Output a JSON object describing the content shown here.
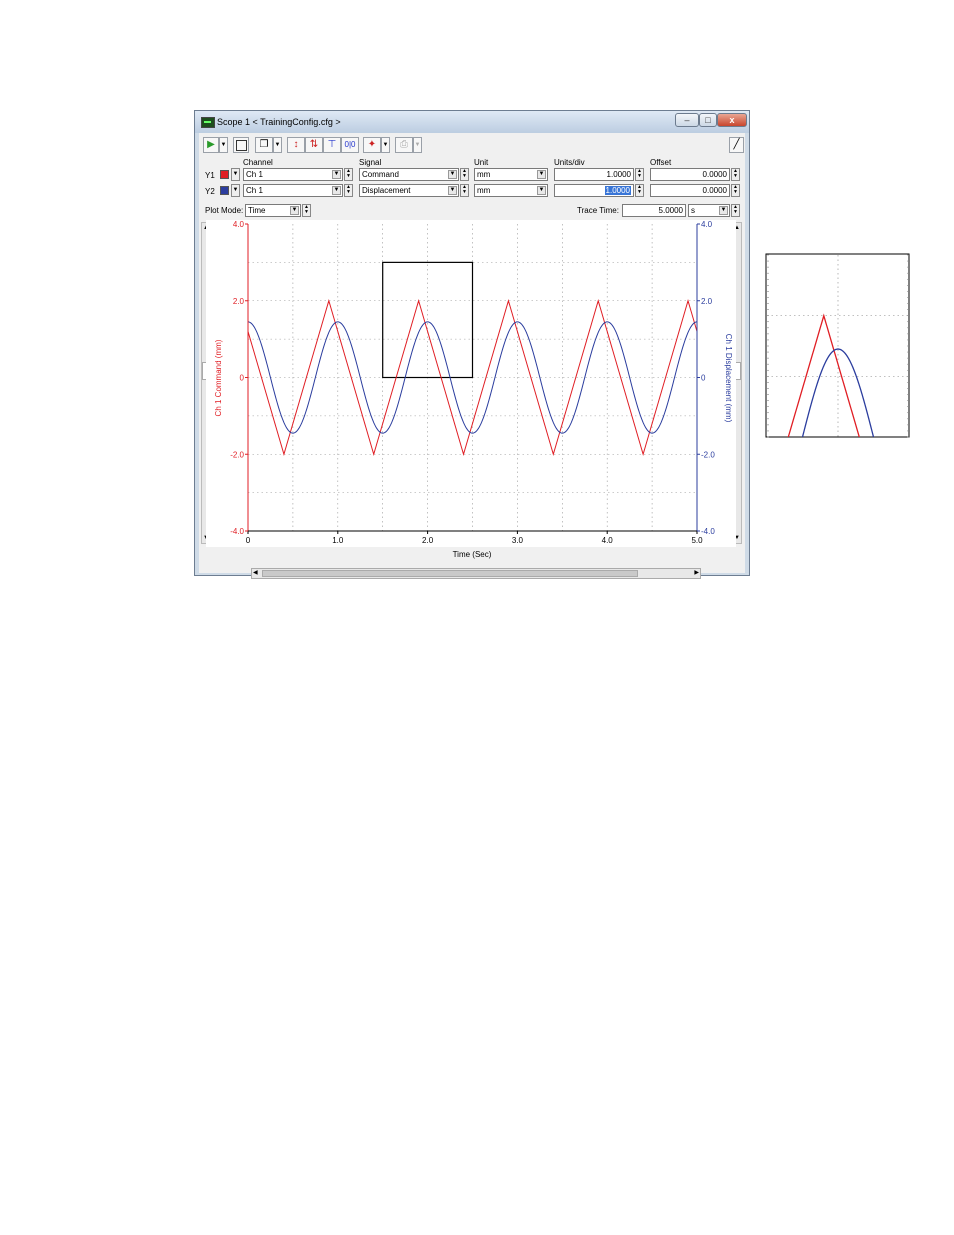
{
  "window": {
    "title": "Scope  1 < TrainingConfig.cfg >",
    "minimize": "–",
    "maximize": "□",
    "close": "x"
  },
  "headers": {
    "channel": "Channel",
    "signal": "Signal",
    "unit": "Unit",
    "units_div": "Units/div",
    "offset": "Offset"
  },
  "rows": [
    {
      "label": "Y1",
      "color": "#e01e24",
      "channel": "Ch 1",
      "signal": "Command",
      "unit": "mm",
      "units_div": "1.0000",
      "offset": "0.0000"
    },
    {
      "label": "Y2",
      "color": "#2b3d9e",
      "channel": "Ch 1",
      "signal": "Displacement",
      "unit": "mm",
      "units_div": "1.0000",
      "offset": "0.0000"
    }
  ],
  "plot_mode": {
    "label": "Plot Mode:",
    "value": "Time"
  },
  "trace_time": {
    "label": "Trace Time:",
    "value": "5.0000",
    "unit": "s"
  },
  "chart_data": {
    "type": "line",
    "xlabel": "Time (Sec)",
    "ylabel_left": "Ch 1 Command (mm)",
    "ylabel_right": "Ch 1 Displacement (mm)",
    "xlim": [
      0,
      5
    ],
    "ylim": [
      -4,
      4
    ],
    "x_ticks": [
      "0",
      "1.0",
      "2.0",
      "3.0",
      "4.0",
      "5.0"
    ],
    "y_ticks_left": [
      "4.0",
      "2.0",
      "0",
      "-2.0",
      "-4.0"
    ],
    "y_ticks_right": [
      "4.0",
      "2.0",
      "0",
      "-2.0",
      "-4.0"
    ],
    "grid": true,
    "series": [
      {
        "name": "Ch 1 Command",
        "color": "#e01e24",
        "shape": "triangle",
        "amplitude": 2.0,
        "period": 1.0,
        "peak_at": 0.9
      },
      {
        "name": "Ch 1 Displacement",
        "color": "#2b3d9e",
        "shape": "sine",
        "amplitude": 1.45,
        "period": 1.0,
        "peak_at": 1.0
      }
    ],
    "zoom_box": {
      "x": [
        1.5,
        2.5
      ],
      "y": [
        0,
        3
      ]
    }
  }
}
